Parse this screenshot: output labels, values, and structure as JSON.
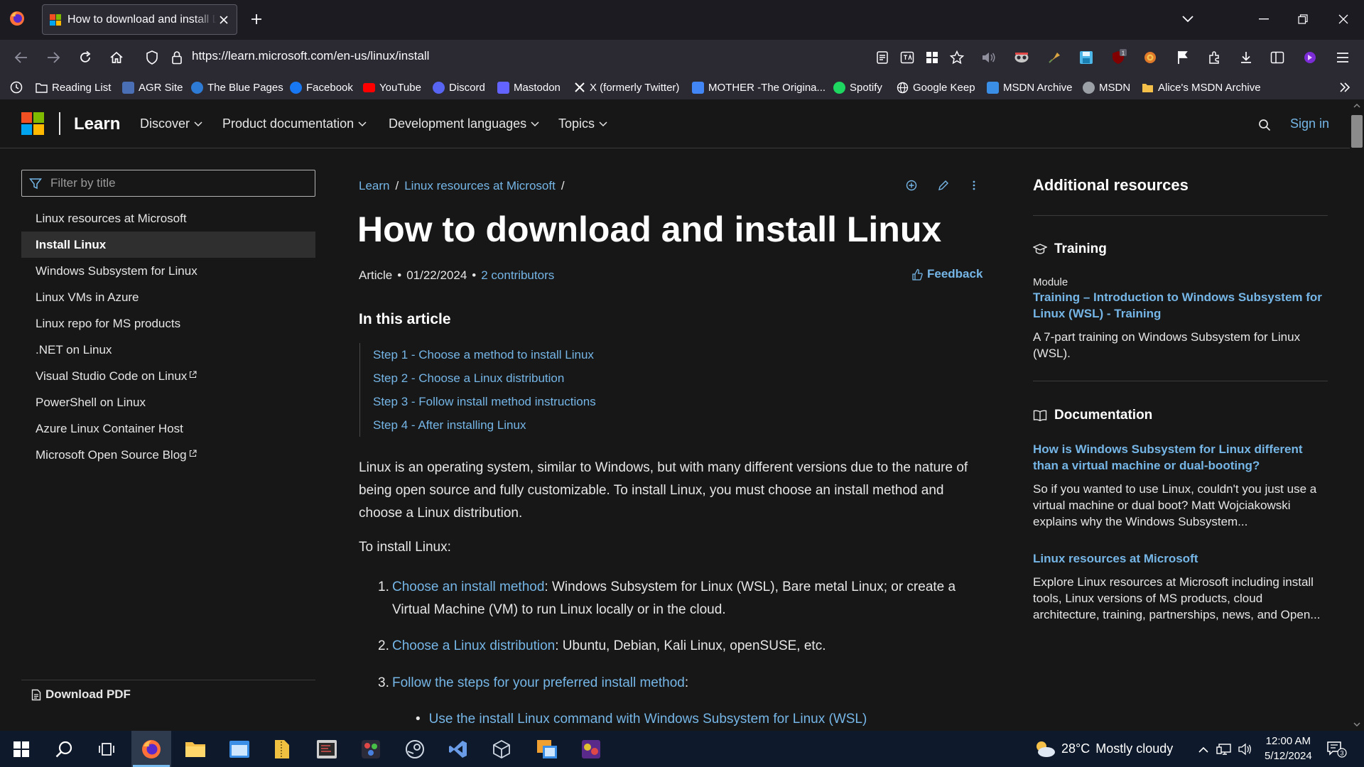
{
  "browser": {
    "tab_title": "How to download and install Linux",
    "url": "https://learn.microsoft.com/en-us/linux/install",
    "extension_badge": "1"
  },
  "bookmarks": [
    {
      "label": "Reading List",
      "icon": "folder-icon",
      "color": "#fbfbfe"
    },
    {
      "label": "AGR Site",
      "icon": "agr-favicon",
      "color": "#4a6fb5"
    },
    {
      "label": "The Blue Pages",
      "icon": "blue-pages-favicon",
      "color": "#2e7bd6"
    },
    {
      "label": "Facebook",
      "icon": "facebook-favicon",
      "color": "#1877f2"
    },
    {
      "label": "YouTube",
      "icon": "youtube-favicon",
      "color": "#ff0000"
    },
    {
      "label": "Discord",
      "icon": "discord-favicon",
      "color": "#5865f2"
    },
    {
      "label": "Mastodon",
      "icon": "mastodon-favicon",
      "color": "#6364ff"
    },
    {
      "label": "X (formerly Twitter)",
      "icon": "x-favicon",
      "color": "#ffffff"
    },
    {
      "label": "MOTHER -The Origina...",
      "icon": "docs-favicon",
      "color": "#4285f4"
    },
    {
      "label": "Spotify",
      "icon": "spotify-favicon",
      "color": "#1ed760"
    },
    {
      "label": "Google Keep",
      "icon": "globe-icon",
      "color": "#fbfbfe"
    },
    {
      "label": "MSDN Archive",
      "icon": "msdn-archive-favicon",
      "color": "#3a8ee6"
    },
    {
      "label": "MSDN",
      "icon": "msdn-favicon",
      "color": "#9aa0a6"
    },
    {
      "label": "Alice's MSDN Archive",
      "icon": "folder-yellow-icon",
      "color": "#f5c04a"
    }
  ],
  "site": {
    "brand": "Learn",
    "menus": [
      "Discover",
      "Product documentation",
      "Development languages",
      "Topics"
    ],
    "sign_in": "Sign in"
  },
  "sidebar": {
    "filter_placeholder": "Filter by title",
    "items": [
      {
        "label": "Linux resources at Microsoft",
        "active": false,
        "external": false
      },
      {
        "label": "Install Linux",
        "active": true,
        "external": false
      },
      {
        "label": "Windows Subsystem for Linux",
        "active": false,
        "external": false
      },
      {
        "label": "Linux VMs in Azure",
        "active": false,
        "external": false
      },
      {
        "label": "Linux repo for MS products",
        "active": false,
        "external": false
      },
      {
        "label": ".NET on Linux",
        "active": false,
        "external": false
      },
      {
        "label": "Visual Studio Code on Linux",
        "active": false,
        "external": true
      },
      {
        "label": "PowerShell on Linux",
        "active": false,
        "external": false
      },
      {
        "label": "Azure Linux Container Host",
        "active": false,
        "external": false
      },
      {
        "label": "Microsoft Open Source Blog",
        "active": false,
        "external": true
      }
    ],
    "download_pdf": "Download PDF"
  },
  "article": {
    "breadcrumb": [
      "Learn",
      "Linux resources at Microsoft"
    ],
    "title": "How to download and install Linux",
    "meta": {
      "type": "Article",
      "date": "01/22/2024",
      "contributors": "2 contributors"
    },
    "feedback": "Feedback",
    "in_this_article": "In this article",
    "toc": [
      "Step 1 - Choose a method to install Linux",
      "Step 2 - Choose a Linux distribution",
      "Step 3 - Follow install method instructions",
      "Step 4 - After installing Linux"
    ],
    "intro": "Linux is an operating system, similar to Windows, but with many different versions due to the nature of being open source and fully customizable. To install Linux, you must choose an install method and choose a Linux distribution.",
    "to_install": "To install Linux:",
    "steps": [
      {
        "num": "1.",
        "link": "Choose an install method",
        "text": ": Windows Subsystem for Linux (WSL), Bare metal Linux; or create a Virtual Machine (VM) to run Linux locally or in the cloud."
      },
      {
        "num": "2.",
        "link": "Choose a Linux distribution",
        "text": ": Ubuntu, Debian, Kali Linux, openSUSE, etc."
      },
      {
        "num": "3.",
        "link": "Follow the steps for your preferred install method",
        "text": ":"
      }
    ],
    "bullet": "Use the install Linux command with Windows Subsystem for Linux (WSL)"
  },
  "resources": {
    "heading": "Additional resources",
    "training": {
      "heading": "Training",
      "kind": "Module",
      "title": "Training – Introduction to Windows Subsystem for Linux (WSL) - Training",
      "desc": "A 7-part training on Windows Subsystem for Linux (WSL)."
    },
    "documentation": {
      "heading": "Documentation",
      "items": [
        {
          "title": "How is Windows Subsystem for Linux different than a virtual machine or dual-booting?",
          "desc": "So if you wanted to use Linux, couldn't you just use a virtual machine or dual boot? Matt Wojciakowski explains why the Windows Subsystem..."
        },
        {
          "title": "Linux resources at Microsoft",
          "desc": "Explore Linux resources at Microsoft including install tools, Linux versions of MS products, cloud architecture, training, partnerships, news, and Open..."
        }
      ]
    }
  },
  "taskbar": {
    "weather": {
      "temp": "28°C",
      "condition": "Mostly cloudy"
    },
    "time": "12:00 AM",
    "date": "5/12/2024",
    "notifications": "3"
  },
  "colors": {
    "accent_link": "#75b6e7",
    "page_bg": "#171717",
    "chrome_bg": "#2b2a33",
    "taskbar_bg": "#0e1a2b"
  }
}
